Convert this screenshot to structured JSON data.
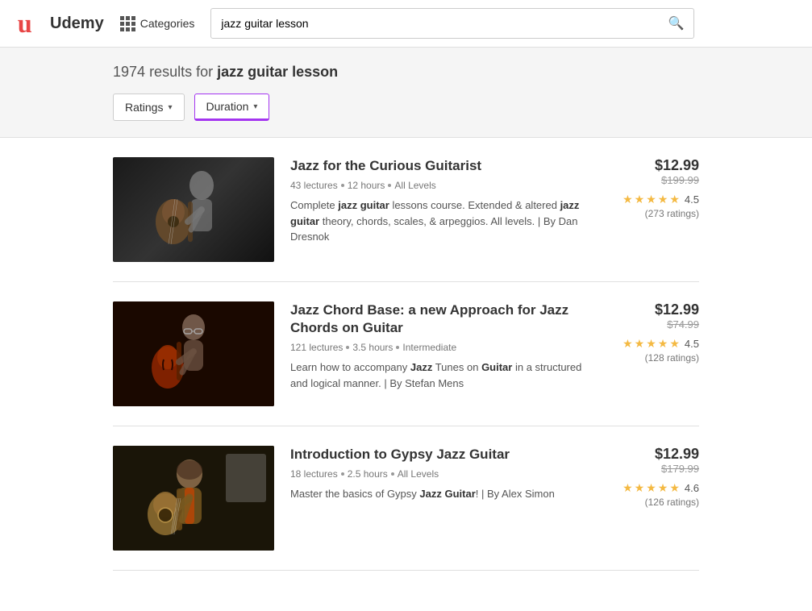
{
  "header": {
    "logo_text": "Udemy",
    "categories_label": "Categories",
    "search_value": "jazz guitar lesson",
    "search_placeholder": "jazz guitar lesson"
  },
  "results": {
    "count": "1974",
    "query": "jazz guitar lesson",
    "results_prefix": "results for"
  },
  "filters": [
    {
      "label": "Ratings",
      "active": false
    },
    {
      "label": "Duration",
      "active": true
    }
  ],
  "courses": [
    {
      "id": 1,
      "title": "Jazz for the Curious Guitarist",
      "lectures": "43 lectures",
      "hours": "12 hours",
      "level": "All Levels",
      "description_parts": [
        "Complete ",
        "jazz guitar",
        " lessons course. Extended & altered ",
        "jazz guitar",
        " theory, chords, scales, & arpeggios. All levels. | By Dan Dresnok"
      ],
      "price_current": "$12.99",
      "price_original": "$199.99",
      "rating": "4.5",
      "ratings_count": "(273 ratings)",
      "stars": 4.5,
      "thumb_class": "thumb-1"
    },
    {
      "id": 2,
      "title": "Jazz Chord Base: a new Approach for Jazz Chords on Guitar",
      "lectures": "121 lectures",
      "hours": "3.5 hours",
      "level": "Intermediate",
      "description_parts": [
        "Learn how to accompany ",
        "Jazz",
        " Tunes on ",
        "Guitar",
        " in a structured and logical manner. | By Stefan Mens"
      ],
      "price_current": "$12.99",
      "price_original": "$74.99",
      "rating": "4.5",
      "ratings_count": "(128 ratings)",
      "stars": 4.5,
      "thumb_class": "thumb-2"
    },
    {
      "id": 3,
      "title": "Introduction to Gypsy Jazz Guitar",
      "lectures": "18 lectures",
      "hours": "2.5 hours",
      "level": "All Levels",
      "description_parts": [
        "Master the basics of Gypsy ",
        "Jazz Guitar",
        "! | By Alex Simon"
      ],
      "price_current": "$12.99",
      "price_original": "$179.99",
      "rating": "4.6",
      "ratings_count": "(126 ratings)",
      "stars": 4.6,
      "thumb_class": "thumb-3"
    }
  ]
}
